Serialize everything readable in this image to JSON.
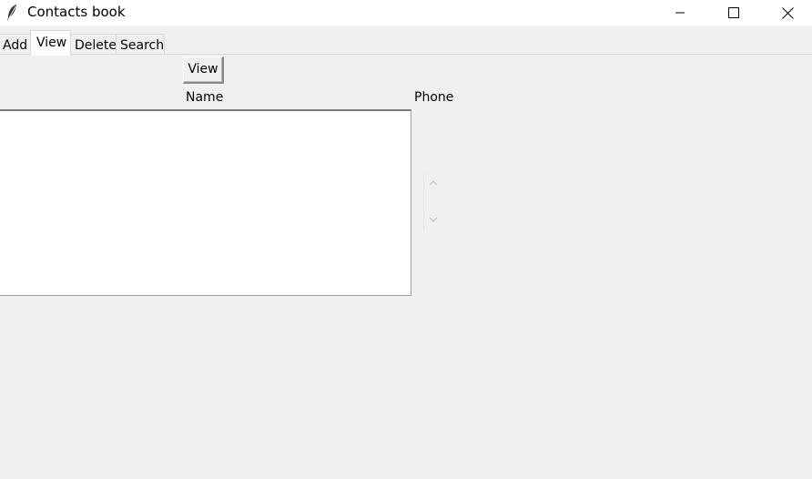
{
  "window": {
    "title": "Contacts book",
    "icon": "feather-icon",
    "controls": {
      "minimize": "minimize-icon",
      "maximize": "maximize-icon",
      "close": "close-icon"
    }
  },
  "tabs": [
    {
      "label": "Add",
      "selected": false
    },
    {
      "label": "View",
      "selected": true
    },
    {
      "label": "Delete",
      "selected": false
    },
    {
      "label": "Search",
      "selected": false
    }
  ],
  "view_panel": {
    "view_button_label": "View",
    "columns": {
      "name": "Name",
      "phone": "Phone"
    },
    "list_items": []
  },
  "colors": {
    "background": "#f0f0f0",
    "titlebar": "#ffffff",
    "listbox": "#ffffff"
  }
}
